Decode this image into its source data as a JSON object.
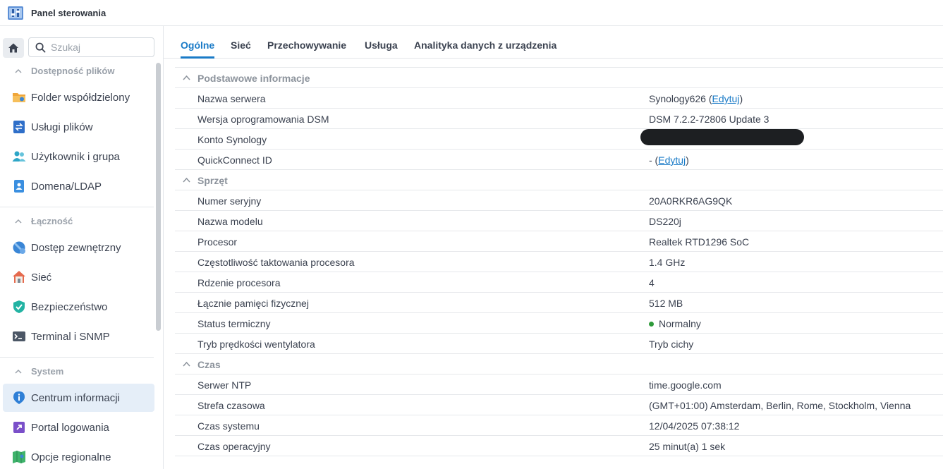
{
  "window": {
    "title": "Panel sterowania"
  },
  "sidebar": {
    "search_placeholder": "Szukaj",
    "groups": [
      {
        "label": "Dostępność plików",
        "items": [
          "Folder współdzielony",
          "Usługi plików",
          "Użytkownik i grupa",
          "Domena/LDAP"
        ]
      },
      {
        "label": "Łączność",
        "items": [
          "Dostęp zewnętrzny",
          "Sieć",
          "Bezpieczeństwo",
          "Terminal i SNMP"
        ]
      },
      {
        "label": "System",
        "items": [
          "Centrum informacji",
          "Portal logowania",
          "Opcje regionalne"
        ]
      }
    ],
    "active_item": "Centrum informacji"
  },
  "tabs": [
    "Ogólne",
    "Sieć",
    "Przechowywanie",
    "Usługa",
    "Analityka danych z urządzenia"
  ],
  "active_tab": "Ogólne",
  "sections": {
    "basic": {
      "title": "Podstawowe informacje",
      "server_name_label": "Nazwa serwera",
      "server_name": "Synology626",
      "edit_label": "Edytuj",
      "dsm_label": "Wersja oprogramowania DSM",
      "dsm_value": "DSM 7.2.2-72806 Update 3",
      "account_label": "Konto Synology",
      "quickconnect_label": "QuickConnect ID",
      "quickconnect_value": "-"
    },
    "hardware": {
      "title": "Sprzęt",
      "rows": [
        {
          "label": "Numer seryjny",
          "value": "20A0RKR6AG9QK"
        },
        {
          "label": "Nazwa modelu",
          "value": "DS220j"
        },
        {
          "label": "Procesor",
          "value": "Realtek RTD1296 SoC"
        },
        {
          "label": "Częstotliwość taktowania procesora",
          "value": "1.4 GHz"
        },
        {
          "label": "Rdzenie procesora",
          "value": "4"
        },
        {
          "label": "Łącznie pamięci fizycznej",
          "value": "512 MB"
        }
      ],
      "thermal_label": "Status termiczny",
      "thermal_value": "Normalny",
      "fan_label": "Tryb prędkości wentylatora",
      "fan_value": "Tryb cichy"
    },
    "time": {
      "title": "Czas",
      "rows": [
        {
          "label": "Serwer NTP",
          "value": "time.google.com"
        },
        {
          "label": "Strefa czasowa",
          "value": "(GMT+01:00) Amsterdam, Berlin, Rome, Stockholm, Vienna"
        },
        {
          "label": "Czas systemu",
          "value": "12/04/2025 07:38:12"
        },
        {
          "label": "Czas operacyjny",
          "value": "25 minut(a) 1 sek"
        }
      ]
    }
  },
  "colors": {
    "accent": "#1a7bc7",
    "status_ok": "#2e9a3a",
    "active_bg": "#e5eef8"
  }
}
